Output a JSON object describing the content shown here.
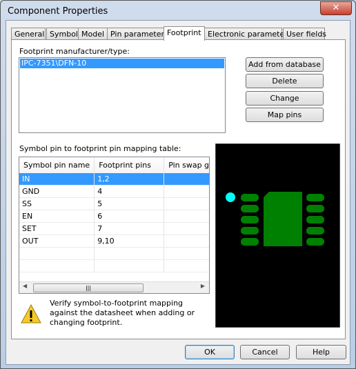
{
  "window": {
    "title": "Component Properties",
    "close_icon": "close-icon"
  },
  "tabs": [
    {
      "label": "General"
    },
    {
      "label": "Symbol"
    },
    {
      "label": "Model"
    },
    {
      "label": "Pin parameters"
    },
    {
      "label": "Footprint",
      "active": true
    },
    {
      "label": "Electronic parameters"
    },
    {
      "label": "User fields"
    }
  ],
  "footprint": {
    "label": "Footprint manufacturer/type:",
    "items": [
      "IPC-7351\\DFN-10"
    ],
    "selected": 0
  },
  "buttons": {
    "add": "Add from database",
    "delete": "Delete",
    "change": "Change",
    "map": "Map pins",
    "ok": "OK",
    "cancel": "Cancel",
    "help": "Help"
  },
  "mapping": {
    "label": "Symbol pin to footprint pin mapping table:",
    "columns": [
      "Symbol pin name",
      "Footprint pins",
      "Pin swap grou"
    ],
    "rows": [
      [
        "IN",
        "1,2",
        ""
      ],
      [
        "GND",
        "4",
        ""
      ],
      [
        "SS",
        "5",
        ""
      ],
      [
        "EN",
        "6",
        ""
      ],
      [
        "SET",
        "7",
        ""
      ],
      [
        "OUT",
        "9,10",
        ""
      ]
    ],
    "selected_row": 0
  },
  "warning": {
    "icon": "warning-icon",
    "text": "Verify symbol-to-footprint mapping against the datasheet when adding or changing footprint."
  },
  "preview": {
    "background": "#000000",
    "pad_color": "#008000",
    "pin1_color": "#00ffff",
    "pads_per_side": 5
  }
}
